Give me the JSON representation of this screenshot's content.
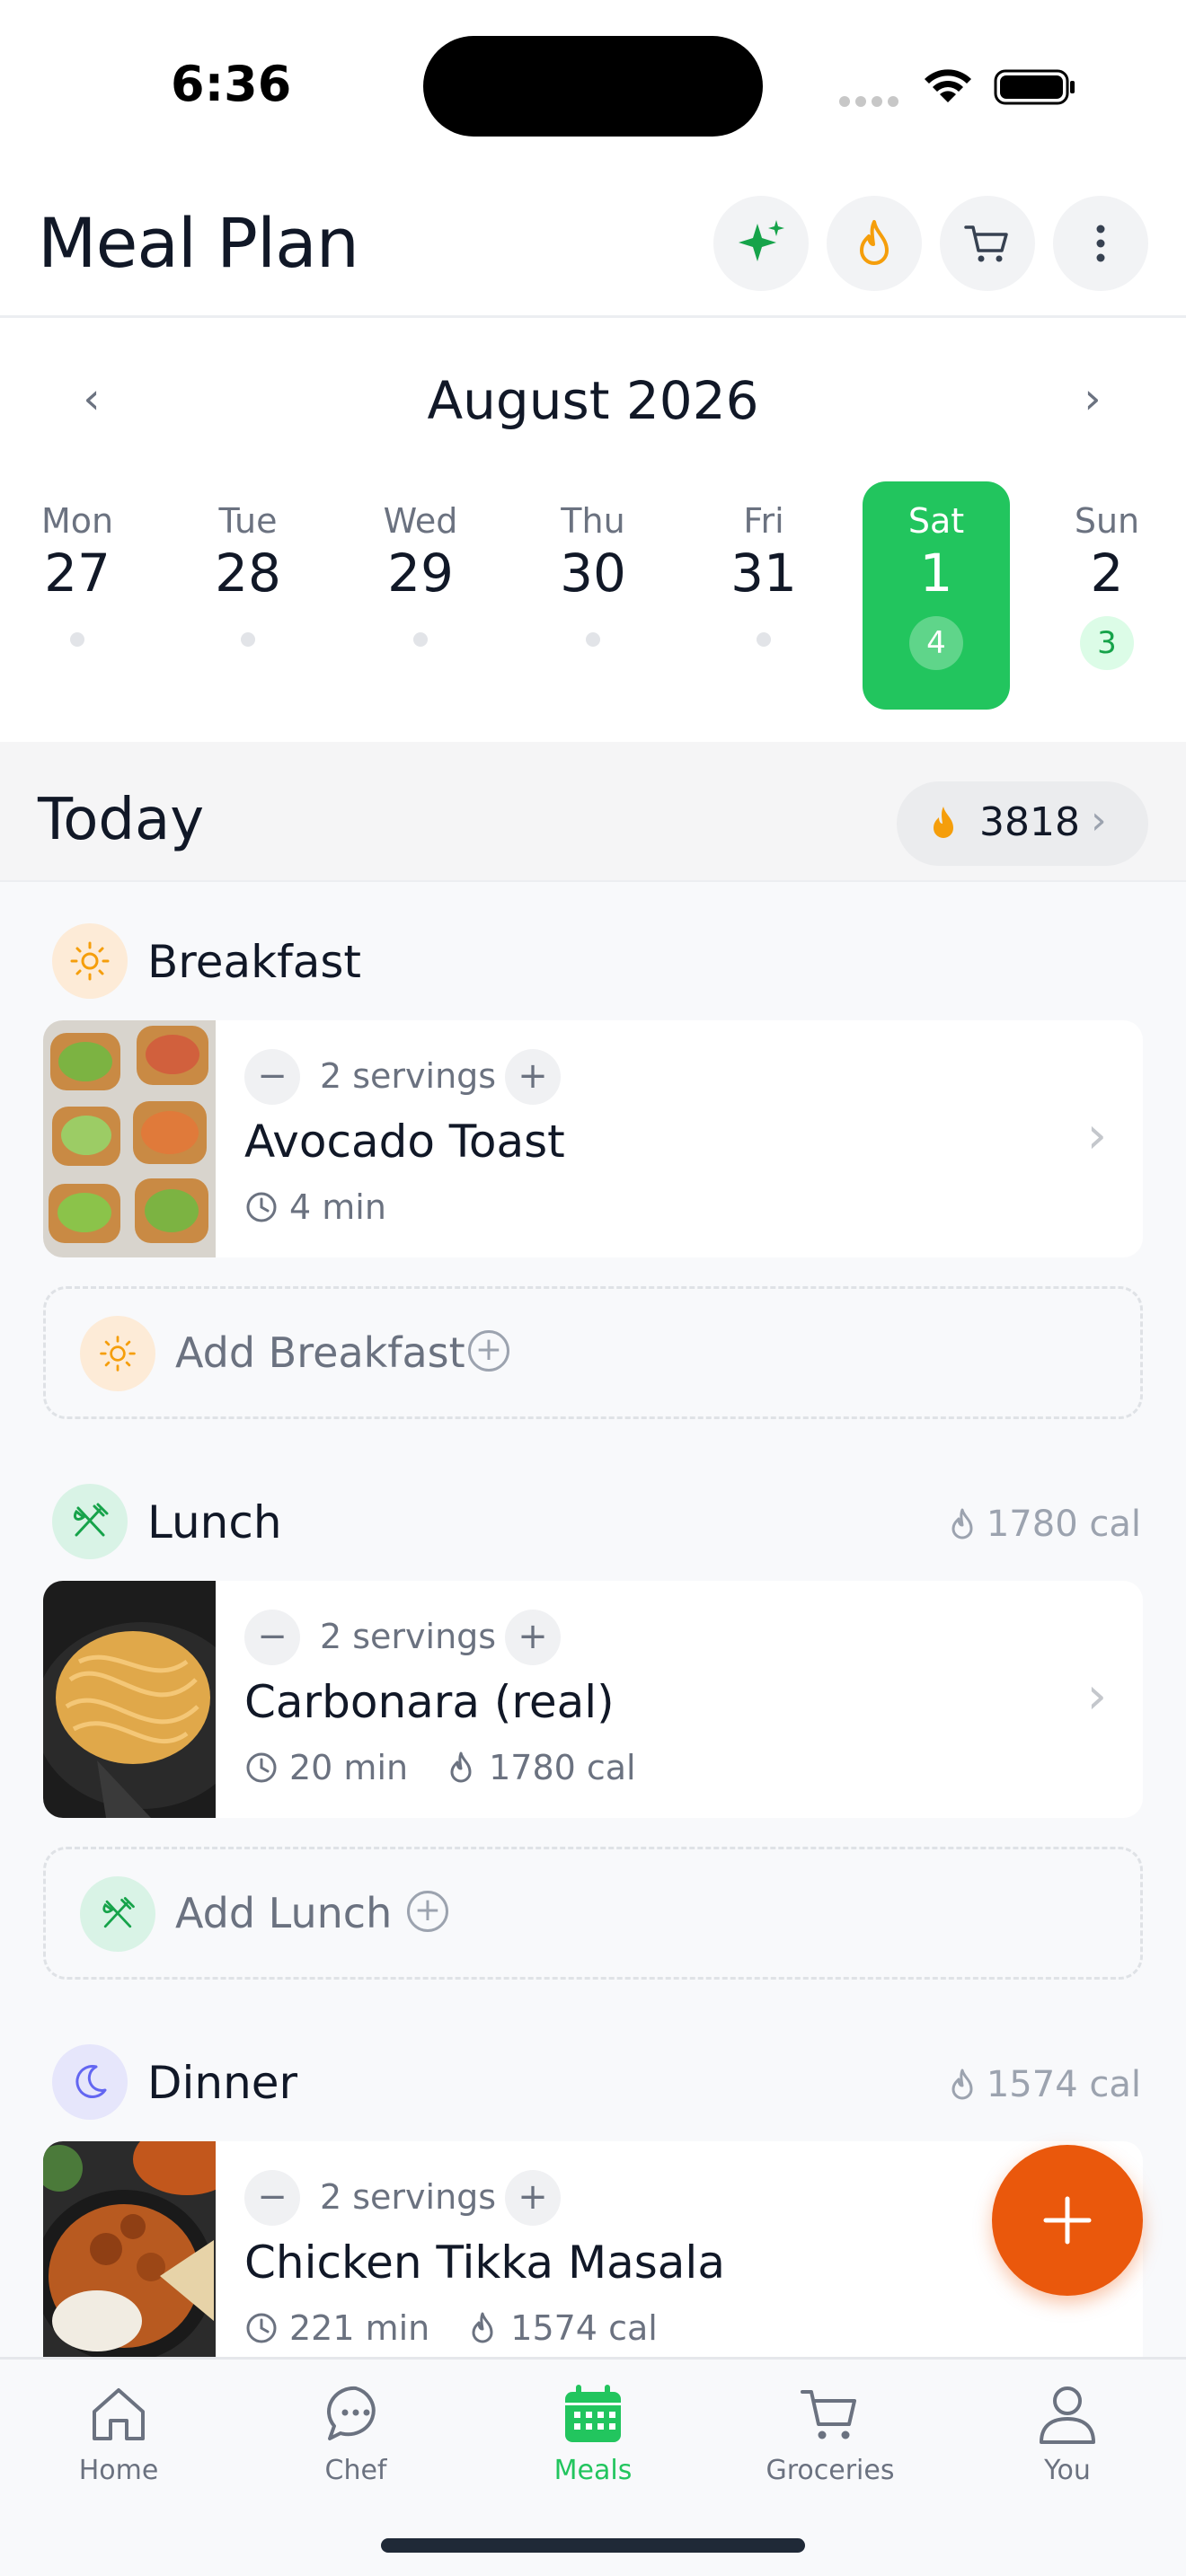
{
  "status_bar": {
    "time": "6:36"
  },
  "header": {
    "title": "Meal Plan"
  },
  "calendar": {
    "month": "August 2026",
    "prev": "‹",
    "next": "›",
    "days": [
      {
        "name": "Mon",
        "num": "27",
        "count": ""
      },
      {
        "name": "Tue",
        "num": "28",
        "count": ""
      },
      {
        "name": "Wed",
        "num": "29",
        "count": ""
      },
      {
        "name": "Thu",
        "num": "30",
        "count": ""
      },
      {
        "name": "Fri",
        "num": "31",
        "count": ""
      },
      {
        "name": "Sat",
        "num": "1",
        "count": "4",
        "selected": true
      },
      {
        "name": "Sun",
        "num": "2",
        "count": "3"
      }
    ]
  },
  "today": {
    "title": "Today",
    "calories": "3818",
    "chevron": "›"
  },
  "sections": {
    "breakfast": {
      "title": "Breakfast",
      "add_label": "Add Breakfast",
      "meal": {
        "servings": "2 servings",
        "name": "Avocado Toast",
        "time": "4 min"
      }
    },
    "lunch": {
      "title": "Lunch",
      "calories": "1780 cal",
      "add_label": "Add Lunch",
      "meal": {
        "servings": "2 servings",
        "name": "Carbonara (real)",
        "time": "20 min",
        "calories": "1780 cal"
      }
    },
    "dinner": {
      "title": "Dinner",
      "calories": "1574 cal",
      "meal": {
        "servings": "2 servings",
        "name": "Chicken Tikka Masala",
        "time": "221 min",
        "calories": "1574 cal"
      }
    }
  },
  "stepper": {
    "minus": "−",
    "plus": "+"
  },
  "card_chevron": "›",
  "add_plus": "+",
  "tabs": [
    {
      "label": "Home",
      "icon": "home-icon"
    },
    {
      "label": "Chef",
      "icon": "chat-icon"
    },
    {
      "label": "Meals",
      "icon": "calendar-icon",
      "active": true
    },
    {
      "label": "Groceries",
      "icon": "cart-icon"
    },
    {
      "label": "You",
      "icon": "user-icon"
    }
  ],
  "colors": {
    "accent_green": "#22c55e",
    "fab_orange": "#ea580c",
    "flame_orange": "#f59e0b",
    "breakfast_bg": "#fdebd7",
    "lunch_bg": "#d9f3e6",
    "dinner_bg": "#e6e6fb"
  }
}
